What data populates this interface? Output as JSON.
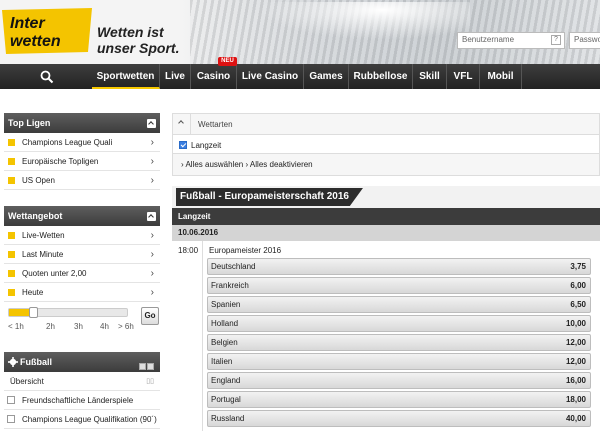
{
  "brand": {
    "logo_line1": "Inter",
    "logo_line2": "wetten",
    "slogan_line1": "Wetten ist",
    "slogan_line2": "unser Sport."
  },
  "login": {
    "username_placeholder": "Benutzername",
    "help": "?",
    "password_placeholder": "Passwort"
  },
  "nav": {
    "items": [
      "Sportwetten",
      "Live",
      "Casino",
      "Live Casino",
      "Games",
      "Rubbellose",
      "Skill",
      "VFL",
      "Mobil"
    ],
    "badge": "NEU"
  },
  "sidebar": {
    "top_ligen": {
      "title": "Top Ligen",
      "items": [
        "Champions League Quali",
        "Europäische Topligen",
        "US Open"
      ]
    },
    "wettangebot": {
      "title": "Wettangebot",
      "items": [
        "Live-Wetten",
        "Last Minute",
        "Quoten unter 2,00",
        "Heute"
      ]
    },
    "slider": {
      "ticks": [
        "< 1h",
        "2h",
        "3h",
        "4h",
        "> 6h"
      ],
      "go": "Go",
      "level": 0.2
    },
    "fussball": {
      "title": "Fußball",
      "items": [
        "Übersicht",
        "Freundschaftliche Länderspiele",
        "Champions League Qualifikation (90´)"
      ]
    }
  },
  "main": {
    "wettarten": {
      "title": "Wettarten",
      "option": "Langzeit",
      "links": "› Alles auswählen  › Alles deaktivieren"
    },
    "competition": {
      "title": "Fußball - Europameisterschaft 2016",
      "subheader": "Langzeit",
      "date": "10.06.2016"
    },
    "event": {
      "time": "18:00",
      "name": "Europameister 2016",
      "odds": [
        {
          "team": "Deutschland",
          "odd": "3,75"
        },
        {
          "team": "Frankreich",
          "odd": "6,00"
        },
        {
          "team": "Spanien",
          "odd": "6,50"
        },
        {
          "team": "Holland",
          "odd": "10,00"
        },
        {
          "team": "Belgien",
          "odd": "12,00"
        },
        {
          "team": "Italien",
          "odd": "12,00"
        },
        {
          "team": "England",
          "odd": "16,00"
        },
        {
          "team": "Portugal",
          "odd": "18,00"
        },
        {
          "team": "Russland",
          "odd": "40,00"
        }
      ]
    }
  },
  "colors": {
    "accent": "#f4c400",
    "nav_bg": "#2b2b2b"
  }
}
